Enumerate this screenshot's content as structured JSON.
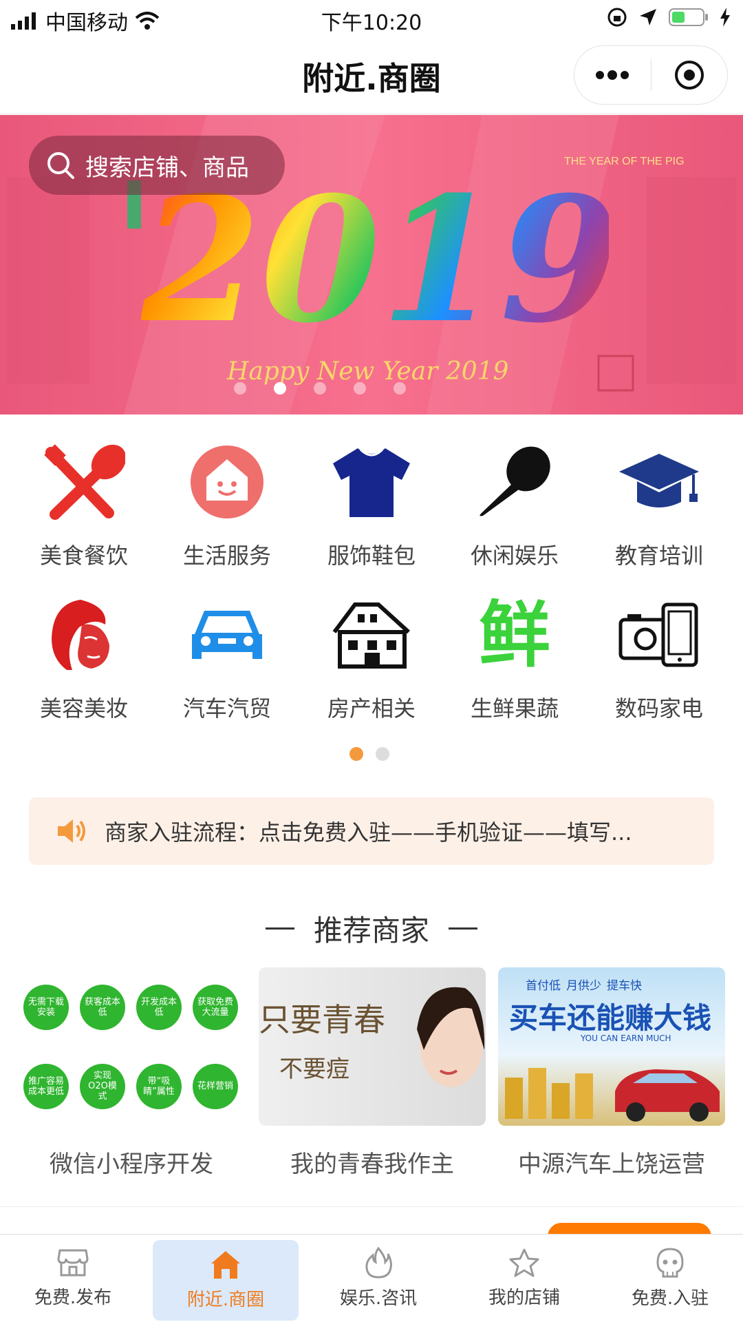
{
  "status_bar": {
    "carrier": "中国移动",
    "time": "下午10:20"
  },
  "nav": {
    "title": "附近.商圈"
  },
  "banner": {
    "search_placeholder": "搜索店铺、商品",
    "year_text": "2019",
    "tagline": "Happy New Year 2019",
    "active_slide": 2,
    "slide_count": 5
  },
  "categories": [
    {
      "label": "美食餐饮",
      "icon": "fork-spoon-icon",
      "color": "#e8302a"
    },
    {
      "label": "生活服务",
      "icon": "house-smile-icon",
      "color": "#ef6f6c"
    },
    {
      "label": "服饰鞋包",
      "icon": "tshirt-icon",
      "color": "#17268c"
    },
    {
      "label": "休闲娱乐",
      "icon": "microphone-icon",
      "color": "#111111"
    },
    {
      "label": "教育培训",
      "icon": "graduation-cap-icon",
      "color": "#1f3a8a"
    },
    {
      "label": "美容美妆",
      "icon": "woman-face-icon",
      "color": "#d81e1e"
    },
    {
      "label": "汽车汽贸",
      "icon": "car-icon",
      "color": "#1f8ee8"
    },
    {
      "label": "房产相关",
      "icon": "building-icon",
      "color": "#111111"
    },
    {
      "label": "生鲜果蔬",
      "icon": "fresh-char-icon",
      "color": "#3bd23b",
      "glyph": "鲜"
    },
    {
      "label": "数码家电",
      "icon": "camera-phone-icon",
      "color": "#111111"
    }
  ],
  "grid_pages": {
    "current": 1,
    "total": 2
  },
  "notice": {
    "text": "商家入驻流程：点击免费入驻——手机验证——填写..."
  },
  "recommend": {
    "title": "推荐商家",
    "items": [
      {
        "name": "微信小程序开发",
        "badges": [
          "无需下载安装",
          "获客成本低",
          "开发成本低",
          "获取免费大流量",
          "推广容易成本更低",
          "实现O2O模式",
          "带“吸睛”属性",
          "花样营销"
        ]
      },
      {
        "name": "我的青春我作主",
        "headline": "只要青春",
        "sub": "不要痘"
      },
      {
        "name": "中源汽车上饶运营",
        "headline": "买车还能赚大钱",
        "tags": [
          "首付低",
          "月供少",
          "提车快"
        ],
        "sub_en": "YOU CAN EARN MUCH"
      }
    ]
  },
  "tabbar": {
    "items": [
      {
        "label": "免费.发布",
        "icon": "shop-icon"
      },
      {
        "label": "附近.商圈",
        "icon": "home-icon",
        "active": true
      },
      {
        "label": "娱乐.咨讯",
        "icon": "flame-icon"
      },
      {
        "label": "我的店铺",
        "icon": "star-icon"
      },
      {
        "label": "免费.入驻",
        "icon": "robot-icon"
      }
    ],
    "active_color": "#f07b1e"
  }
}
